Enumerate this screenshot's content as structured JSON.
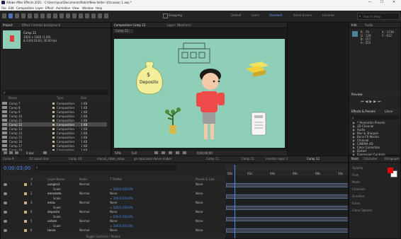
{
  "app": {
    "title": "Adobe After Effects 2021 - C:\\Users\\pua\\Documents\\Robin\\New folder (4)\\cuaaar 1.aep *",
    "window_controls": {
      "minimize": "—",
      "maximize": "☐",
      "close": "✕"
    }
  },
  "menu": [
    "File",
    "Edit",
    "Composition",
    "Layer",
    "Effect",
    "Animation",
    "View",
    "Window",
    "Help"
  ],
  "toolbar": {
    "snapping_label": "Snapping",
    "workspaces": [
      "Default",
      "Learn",
      "Standard",
      "Small Screen",
      "Libraries"
    ],
    "active_workspace": "Standard",
    "search_placeholder": "Search Help"
  },
  "project": {
    "tabs": [
      "Project",
      "Effect Controls background"
    ],
    "selected_name": "Comp 12",
    "selected_meta_1": "1920 x 1080 (1.00)",
    "selected_meta_2": "Δ 0;00;10;00, 30.00 fps",
    "search_placeholder": "ρ",
    "columns": {
      "name": "Name",
      "type": "Type",
      "size": "Size"
    },
    "items": [
      {
        "name": "Comp 7",
        "type": "Composition",
        "size": "1 KB"
      },
      {
        "name": "Comp 8",
        "type": "Composition",
        "size": "1 KB"
      },
      {
        "name": "Comp 9",
        "type": "Composition",
        "size": "1 KB"
      },
      {
        "name": "Comp 10",
        "type": "Composition",
        "size": "1 KB"
      },
      {
        "name": "Comp 11",
        "type": "Composition",
        "size": "1 KB"
      },
      {
        "name": "Comp 12",
        "type": "Composition",
        "size": "1 KB"
      },
      {
        "name": "Comp 13",
        "type": "Composition",
        "size": "1 KB"
      },
      {
        "name": "Comp 14",
        "type": "Composition",
        "size": "1 KB"
      },
      {
        "name": "Comp 15",
        "type": "Composition",
        "size": "1 KB"
      },
      {
        "name": "Comp 16",
        "type": "Composition",
        "size": "1 KB"
      },
      {
        "name": "Comp 17",
        "type": "Composition",
        "size": "1 KB"
      },
      {
        "name": "Comp 18",
        "type": "Composition",
        "size": "1 KB"
      }
    ],
    "selected_index": 5,
    "bottom_bits": "8 bpc"
  },
  "composition": {
    "tabs": [
      "Composition Comp 12",
      "Layer: (Nenhum)"
    ],
    "subtab": "Comp 12",
    "scene_labels": {
      "money_bag": "$",
      "deposito": "Deposito"
    },
    "footer": {
      "zoom": "50%",
      "quality": "Full",
      "timecode": "0;00;00;00"
    }
  },
  "right_panel": {
    "info_tab": "Info",
    "audio_tab": "Audio",
    "info_lines": [
      "R : 79",
      "G : 129",
      "B : 157",
      "A : 255",
      "X : 1739",
      "Y : 612"
    ],
    "preview_tab": "Preview",
    "effects_tabs": [
      "Effects & Presets",
      "Librar"
    ],
    "effects_search": "ρ",
    "effects_items": [
      "* Animation Presets",
      "3D Channel",
      "Audio",
      "Blur & Sharpen",
      "Boris FX Mocha",
      "Channel",
      "CINEMA 4D",
      "Color Correction",
      "Distort",
      "Expression Controls"
    ]
  },
  "timeline": {
    "tabs": [
      "Comp 9",
      "10 Lokasi Gas",
      "Comp 10",
      "maculi_rabel_setup",
      "gs-rapa base dance maker",
      "Comp 11",
      "Comp 11",
      "investor layer 2",
      "Comp 12"
    ],
    "active_tab": "Comp 12",
    "timecode": "0;00;03;00",
    "columns": {
      "num": "#",
      "name": "Layer Name",
      "mode": "Mode",
      "trkmat": "T TrkMat",
      "parent": "Parent & Link"
    },
    "ruler": [
      "00s",
      "02s",
      "04s",
      "06s",
      "08s",
      "10s"
    ],
    "layers": [
      {
        "num": "1",
        "name": "uangan1",
        "mode": "Normal",
        "trkmat": "",
        "parent": "None",
        "prop": ""
      },
      {
        "num": "",
        "name": "Scale",
        "mode": "",
        "trkmat": "",
        "parent": "",
        "prop": "∞ 100.0,100.0%"
      },
      {
        "num": "2",
        "name": "emaskota",
        "mode": "Normal",
        "trkmat": "None",
        "parent": "None",
        "prop": ""
      },
      {
        "num": "",
        "name": "Scale",
        "mode": "",
        "trkmat": "",
        "parent": "",
        "prop": "∞ 100.0,100.0%"
      },
      {
        "num": "3",
        "name": "emas",
        "mode": "Normal",
        "trkmat": "None",
        "parent": "None",
        "prop": ""
      },
      {
        "num": "",
        "name": "Scale",
        "mode": "",
        "trkmat": "",
        "parent": "",
        "prop": "∞ 100.0,100.0%"
      },
      {
        "num": "4",
        "name": "deposito",
        "mode": "Normal",
        "trkmat": "None",
        "parent": "None",
        "prop": ""
      },
      {
        "num": "",
        "name": "Scale",
        "mode": "",
        "trkmat": "",
        "parent": "",
        "prop": "∞ 100.0,100.0%"
      },
      {
        "num": "5",
        "name": "saham",
        "mode": "Normal",
        "trkmat": "None",
        "parent": "None",
        "prop": ""
      },
      {
        "num": "",
        "name": "Scale",
        "mode": "",
        "trkmat": "",
        "parent": "",
        "prop": "∞ 100.0,100.0%"
      },
      {
        "num": "6",
        "name": "tanaa",
        "mode": "Normal",
        "trkmat": "None",
        "parent": "None",
        "prop": ""
      }
    ],
    "bottom_label": "Toggle Switches / Modes"
  },
  "paint": {
    "tabs": [
      "Paint",
      "Character",
      "Paragraph"
    ],
    "fields": [
      "Opacity",
      "Flow",
      "Mode",
      "Channels",
      "Duration",
      "Erase",
      "Clone Options"
    ],
    "fg_color": "#e60000",
    "bg_color": "#ffffff"
  }
}
